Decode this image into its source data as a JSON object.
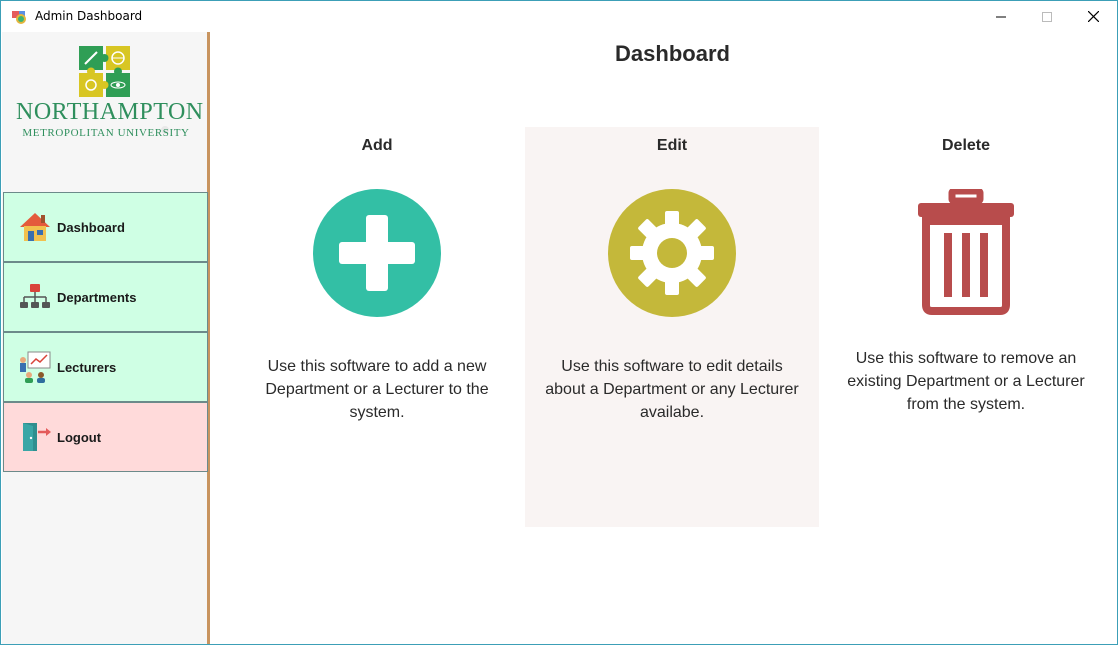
{
  "window": {
    "title": "Admin Dashboard"
  },
  "sidebar": {
    "logo": {
      "name": "NORTHAMPTON",
      "subtitle": "METROPOLITAN UNIVERSITY"
    },
    "items": [
      {
        "label": "Dashboard",
        "icon": "house-icon",
        "color": "#cfffe4"
      },
      {
        "label": "Departments",
        "icon": "org-chart-icon",
        "color": "#cfffe4"
      },
      {
        "label": "Lecturers",
        "icon": "classroom-icon",
        "color": "#cfffe4"
      },
      {
        "label": "Logout",
        "icon": "exit-door-icon",
        "color": "#ffdada"
      }
    ]
  },
  "main": {
    "title": "Dashboard",
    "cards": [
      {
        "title": "Add",
        "icon": "plus-circle-icon",
        "color": "#33bfa5",
        "description": "Use this software to add a new Department or a Lecturer to the system."
      },
      {
        "title": "Edit",
        "icon": "gear-icon",
        "color": "#c4b83a",
        "description": "Use this software to edit details about a Department or any Lecturer availabe."
      },
      {
        "title": "Delete",
        "icon": "trash-icon",
        "color": "#b84c4c",
        "description": "Use this software to remove an existing Department or a Lecturer from the system."
      }
    ]
  },
  "colors": {
    "sidebar_accent": "#c8945f",
    "window_border": "#3c9fb7"
  }
}
